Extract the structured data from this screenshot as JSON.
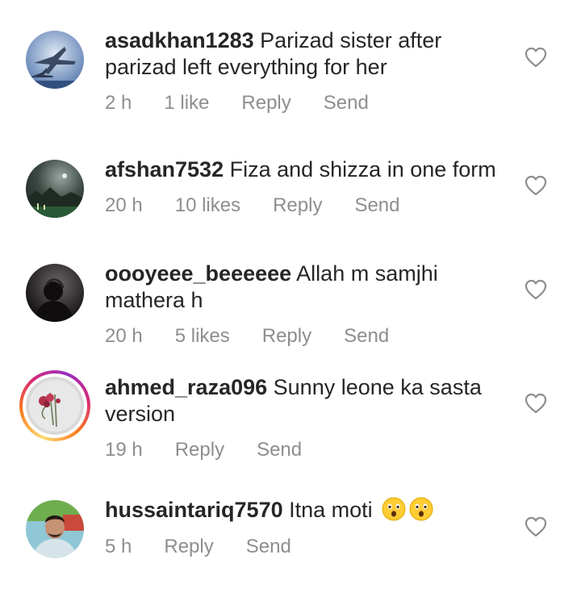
{
  "comments": [
    {
      "username": "asadkhan1283",
      "text": "Parizad sister after parizad left everything for her",
      "time": "2 h",
      "likes": "1 like",
      "reply": "Reply",
      "send": "Send",
      "avatar": "jet-fighters-photo"
    },
    {
      "username": "afshan7532",
      "text": "Fiza and shizza in one form",
      "time": "20 h",
      "likes": "10 likes",
      "reply": "Reply",
      "send": "Send",
      "avatar": "night-landscape-photo"
    },
    {
      "username": "oooyeee_beeeeee",
      "text": "Allah m samjhi mathera h",
      "time": "20 h",
      "likes": "5 likes",
      "reply": "Reply",
      "send": "Send",
      "avatar": "dark-silhouette-photo"
    },
    {
      "username": "ahmed_raza096",
      "text": "Sunny leone ka sasta version",
      "time": "19 h",
      "reply": "Reply",
      "send": "Send",
      "avatar": "roses-photo",
      "story_ring": true
    },
    {
      "username": "hussaintariq7570",
      "text": "Itna moti",
      "emojis": [
        "astonished-face-emoji",
        "astonished-face-emoji"
      ],
      "time": "5 h",
      "reply": "Reply",
      "send": "Send",
      "avatar": "man-selfie-photo"
    }
  ],
  "icons": {
    "like": "heart-outline-icon"
  },
  "colors": {
    "text": "#262626",
    "meta": "#8e8e8e",
    "story_ring": [
      "#feda75",
      "#fa7e1e",
      "#d62976",
      "#962fbf"
    ]
  }
}
